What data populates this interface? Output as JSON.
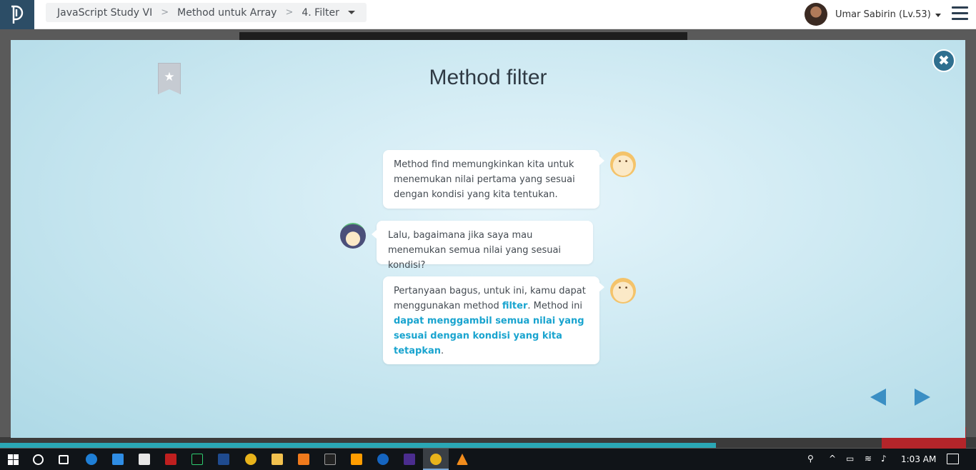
{
  "app": {
    "logo_letter": "D"
  },
  "breadcrumb": {
    "items": [
      "JavaScript Study VI",
      "Method untuk Array",
      "4. Filter"
    ],
    "separator": ">"
  },
  "user": {
    "name": "Umar Sabirin (Lv.53)"
  },
  "modal": {
    "title": "Method filter",
    "close_label": "✖",
    "bookmark_icon": "★",
    "messages": [
      {
        "speaker": "mentor",
        "text": "Method find memungkinkan kita untuk menemukan nilai pertama yang sesuai dengan kondisi yang kita tentukan."
      },
      {
        "speaker": "student",
        "text": "Lalu, bagaimana jika saya mau menemukan semua nilai yang sesuai kondisi?"
      },
      {
        "speaker": "mentor",
        "parts": [
          "Pertanyaan bagus, untuk ini, kamu dapat menggunakan method ",
          "filter",
          ". Method ini ",
          "dapat menggambil semua nilai yang sesuai dengan kondisi yang kita tetapkan",
          "."
        ]
      }
    ],
    "nav": {
      "prev_icon": "triangle-left-icon",
      "next_icon": "triangle-right-icon"
    },
    "accent_color": "#19a4cf"
  },
  "taskbar": {
    "clock": "1:03 AM",
    "apps": [
      "start",
      "cortana-search",
      "task-view",
      "edge",
      "mail",
      "store",
      "filezilla",
      "pycharm",
      "media-player",
      "chrome",
      "file-explorer",
      "xampp",
      "git",
      "sublime",
      "maps",
      "phpstorm",
      "chrome-active",
      "vlc"
    ]
  }
}
